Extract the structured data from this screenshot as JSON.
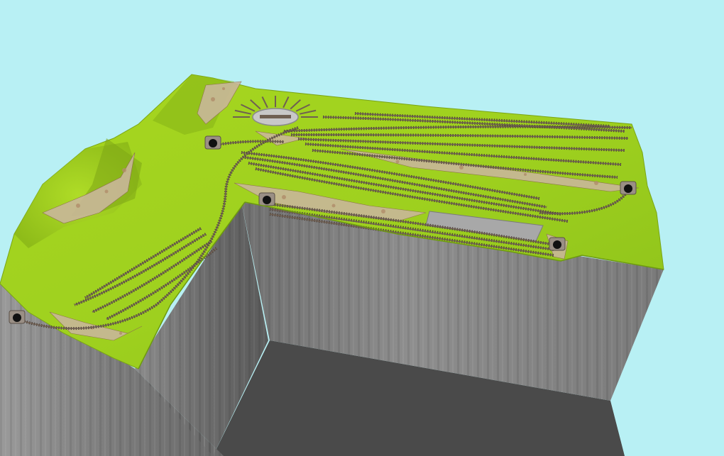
{
  "viewport": {
    "sky_color": "#b8f0f4",
    "floor_color": "#4a4a4a"
  },
  "layout_model": {
    "terrain": {
      "grass_color": "#9fd11f",
      "grass_shade_color": "#7aa515",
      "cliff_color": "#8a8a8a",
      "cliff_dark_color": "#5e5e5e",
      "rock_color": "#c9b79a"
    },
    "rails": {
      "track_color": "#6f5f52",
      "sleeper_color": "#4d4038"
    },
    "turntable": {
      "icon": "turntable-icon",
      "color": "#c8c8c8"
    },
    "tunnel_portals": [
      {
        "name": "tunnel-portal-west",
        "icon": "tunnel-portal-icon"
      },
      {
        "name": "tunnel-portal-north",
        "icon": "tunnel-portal-icon"
      },
      {
        "name": "tunnel-portal-center",
        "icon": "tunnel-portal-icon"
      },
      {
        "name": "tunnel-portal-east",
        "icon": "tunnel-portal-icon"
      },
      {
        "name": "tunnel-portal-southeast",
        "icon": "tunnel-portal-icon"
      }
    ],
    "station_platform": {
      "icon": "platform-icon",
      "color": "#a8a8a8"
    }
  }
}
